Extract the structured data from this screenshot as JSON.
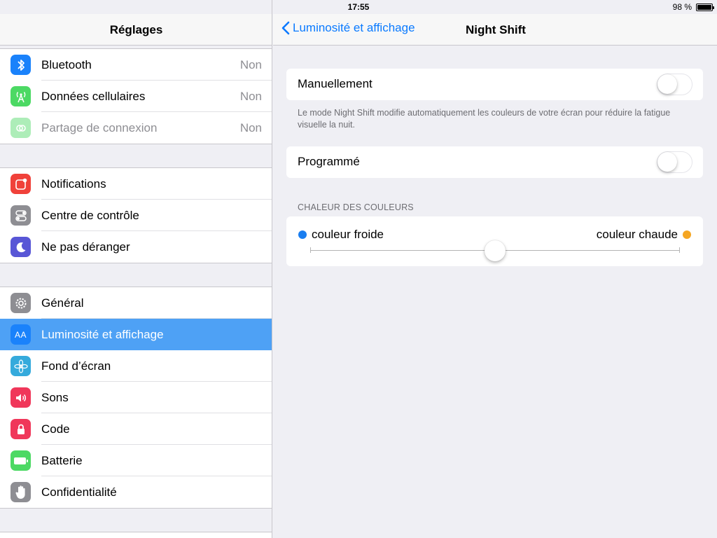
{
  "status_bar": {
    "device": "iPad",
    "time": "17:55",
    "battery": "98 %",
    "battery_level": 0.98
  },
  "sidebar": {
    "title": "Réglages",
    "groups": [
      {
        "items": [
          {
            "label": "Bluetooth",
            "value": "Non",
            "icon": "bluetooth-icon",
            "color": "#1a82fb"
          },
          {
            "label": "Données cellulaires",
            "value": "Non",
            "icon": "cellular-icon",
            "color": "#4cd964"
          },
          {
            "label": "Partage de connexion",
            "value": "Non",
            "icon": "hotspot-icon",
            "color": "#4cd964",
            "disabled": true
          }
        ]
      },
      {
        "items": [
          {
            "label": "Notifications",
            "icon": "notifications-icon",
            "color": "#f0413a"
          },
          {
            "label": "Centre de contrôle",
            "icon": "control-center-icon",
            "color": "#8e8e93"
          },
          {
            "label": "Ne pas déranger",
            "icon": "moon-icon",
            "color": "#5856d6"
          }
        ]
      },
      {
        "items": [
          {
            "label": "Général",
            "icon": "gear-icon",
            "color": "#8e8e93"
          },
          {
            "label": "Luminosité et affichage",
            "icon": "brightness-icon",
            "color": "#1a82fb",
            "selected": true,
            "icon_text": "AA"
          },
          {
            "label": "Fond d’écran",
            "icon": "wallpaper-icon",
            "color": "#35aadc"
          },
          {
            "label": "Sons",
            "icon": "speaker-icon",
            "color": "#f0375a"
          },
          {
            "label": "Code",
            "icon": "lock-icon",
            "color": "#f0375a"
          },
          {
            "label": "Batterie",
            "icon": "battery-icon",
            "color": "#4cd964"
          },
          {
            "label": "Confidentialité",
            "icon": "hand-icon",
            "color": "#8e8e93"
          }
        ]
      }
    ]
  },
  "detail": {
    "back_label": "Luminosité et affichage",
    "title": "Night Shift",
    "manual": {
      "label": "Manuellement",
      "on": false
    },
    "manual_footnote": "Le mode Night Shift modifie automatiquement les couleurs de votre écran pour réduire la fatigue visuelle la nuit.",
    "scheduled": {
      "label": "Programmé",
      "on": false
    },
    "temperature": {
      "section_header": "CHALEUR DES COULEURS",
      "cold_label": "couleur froide",
      "warm_label": "couleur chaude",
      "cold_color": "#1a7ef0",
      "warm_color": "#f5a623",
      "level": 0.5
    }
  },
  "colors": {
    "accent": "#0a7aff",
    "selection": "#4ea1f5"
  }
}
